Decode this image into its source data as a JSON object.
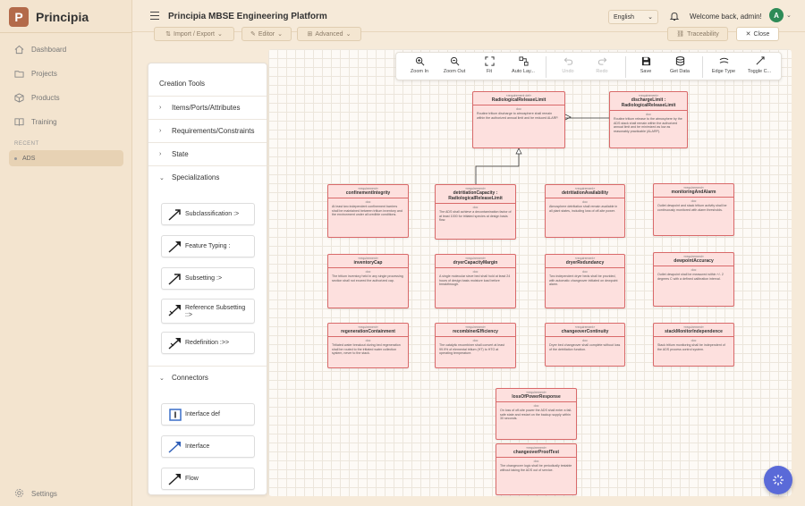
{
  "brand": {
    "letter": "P",
    "name": "Principia"
  },
  "sidebar": {
    "items": [
      {
        "label": "Dashboard"
      },
      {
        "label": "Projects"
      },
      {
        "label": "Products"
      },
      {
        "label": "Training"
      }
    ],
    "recent_label": "RECENT",
    "recent_item": "ADS",
    "settings": "Settings"
  },
  "header": {
    "title": "Principia MBSE Engineering Platform",
    "language": "English",
    "welcome": "Welcome back, admin!",
    "avatar_initial": "A"
  },
  "toolbar": {
    "import_export": "Import / Export",
    "editor": "Editor",
    "advanced": "Advanced",
    "traceability": "Traceability",
    "close": "Close"
  },
  "tools": {
    "title": "Creation Tools",
    "sections": [
      {
        "label": "Items/Ports/Attributes"
      },
      {
        "label": "Requirements/Constraints"
      },
      {
        "label": "State"
      },
      {
        "label": "Specializations"
      },
      {
        "label": "Connectors"
      }
    ],
    "specializations": [
      {
        "label": "Subclassification :>"
      },
      {
        "label": "Feature Typing :"
      },
      {
        "label": "Subsetting :>"
      },
      {
        "label": "Reference Subsetting ::>"
      },
      {
        "label": "Redefinition :>>"
      }
    ],
    "connectors": [
      {
        "label": "Interface def"
      },
      {
        "label": "Interface"
      },
      {
        "label": "Flow"
      }
    ]
  },
  "diagram_toolbar": [
    {
      "label": "Zoom In",
      "icon": "zoom-in-icon"
    },
    {
      "label": "Zoom Out",
      "icon": "zoom-out-icon"
    },
    {
      "label": "Fit",
      "icon": "fit-icon"
    },
    {
      "label": "Auto Lay...",
      "icon": "auto-layout-icon"
    },
    {
      "label": "Undo",
      "icon": "undo-icon"
    },
    {
      "label": "Redo",
      "icon": "redo-icon"
    },
    {
      "label": "Save",
      "icon": "save-icon"
    },
    {
      "label": "Get Data",
      "icon": "database-icon"
    },
    {
      "label": "Edge Type",
      "icon": "edge-type-icon"
    },
    {
      "label": "Toggle C...",
      "icon": "toggle-icon"
    }
  ],
  "requirements": [
    {
      "stereo": "«requirement def»",
      "name": "RadiologicalReleaseLimit",
      "doc": "doc",
      "text": "Routine tritium discharge to atmosphere shall remain within the authorized annual limit and be reduced ALARP."
    },
    {
      "stereo": "«requirement»",
      "name": "dischargeLimit : RadiologicalReleaseLimit",
      "doc": "doc",
      "text": "Routine tritium release to the atmosphere by the ADS stack shall remain within the authorized annual limit and be minimized as low as reasonably practicable (ALARP)."
    },
    {
      "stereo": "«requirement»",
      "name": "confinementIntegrity",
      "doc": "doc",
      "text": "At least two independent confinement barriers shall be maintained between tritium inventory and the environment under all credible conditions."
    },
    {
      "stereo": "«requirement»",
      "name": "detritiationCapacity : RadiologicalReleaseLimit",
      "doc": "doc",
      "text": "The ADS shall achieve a decontamination factor of at least 1000 for tritiated species at design basis flow."
    },
    {
      "stereo": "«requirement»",
      "name": "detritiationAvailability",
      "doc": "doc",
      "text": "Atmosphere detritiation shall remain available in all plant states, including loss of off-site power."
    },
    {
      "stereo": "«requirement»",
      "name": "monitoringAndAlarm",
      "doc": "doc",
      "text": "Outlet dewpoint and stack tritium activity shall be continuously monitored with alarm thresholds."
    },
    {
      "stereo": "«requirement»",
      "name": "inventoryCap",
      "doc": "doc",
      "text": "The tritium inventory held in any single processing section shall not exceed the authorized cap."
    },
    {
      "stereo": "«requirement»",
      "name": "dryerCapacityMargin",
      "doc": "doc",
      "text": "A single molecular sieve bed shall hold at least 24 hours of design basis moisture load before breakthrough."
    },
    {
      "stereo": "«requirement»",
      "name": "dryerRedundancy",
      "doc": "doc",
      "text": "Two independent dryer beds shall be provided, with automatic changeover initiated on dewpoint alarm."
    },
    {
      "stereo": "«requirement»",
      "name": "dewpointAccuracy",
      "doc": "doc",
      "text": "Outlet dewpoint shall be measured within +/- 2 degrees C with a defined calibration interval."
    },
    {
      "stereo": "«requirement»",
      "name": "regenerationContainment",
      "doc": "doc",
      "text": "Tritiated water breakout during bed regeneration shall be routed to the tritiated water collection system, never to the stack."
    },
    {
      "stereo": "«requirement»",
      "name": "recombinerEfficiency",
      "doc": "doc",
      "text": "The catalytic recombiner shall convert at least 99.9% of elemental tritium (HT) to HTO at operating temperature."
    },
    {
      "stereo": "«requirement»",
      "name": "changeoverContinuity",
      "doc": "doc",
      "text": "Dryer bed changeover shall complete without loss of the detritiation function."
    },
    {
      "stereo": "«requirement»",
      "name": "stackMonitorIndependence",
      "doc": "doc",
      "text": "Stack tritium monitoring shall be independent of the ADS process control system."
    },
    {
      "stereo": "«requirement»",
      "name": "lossOfPowerResponse",
      "doc": "doc",
      "text": "On loss of off-site power the ADS shall enter a fail-safe state and restart on the backup supply within 30 seconds."
    },
    {
      "stereo": "«requirement»",
      "name": "changeoverProofTest",
      "doc": "doc",
      "text": "The changeover logic shall be periodically testable without taking the ADS out of service."
    }
  ]
}
